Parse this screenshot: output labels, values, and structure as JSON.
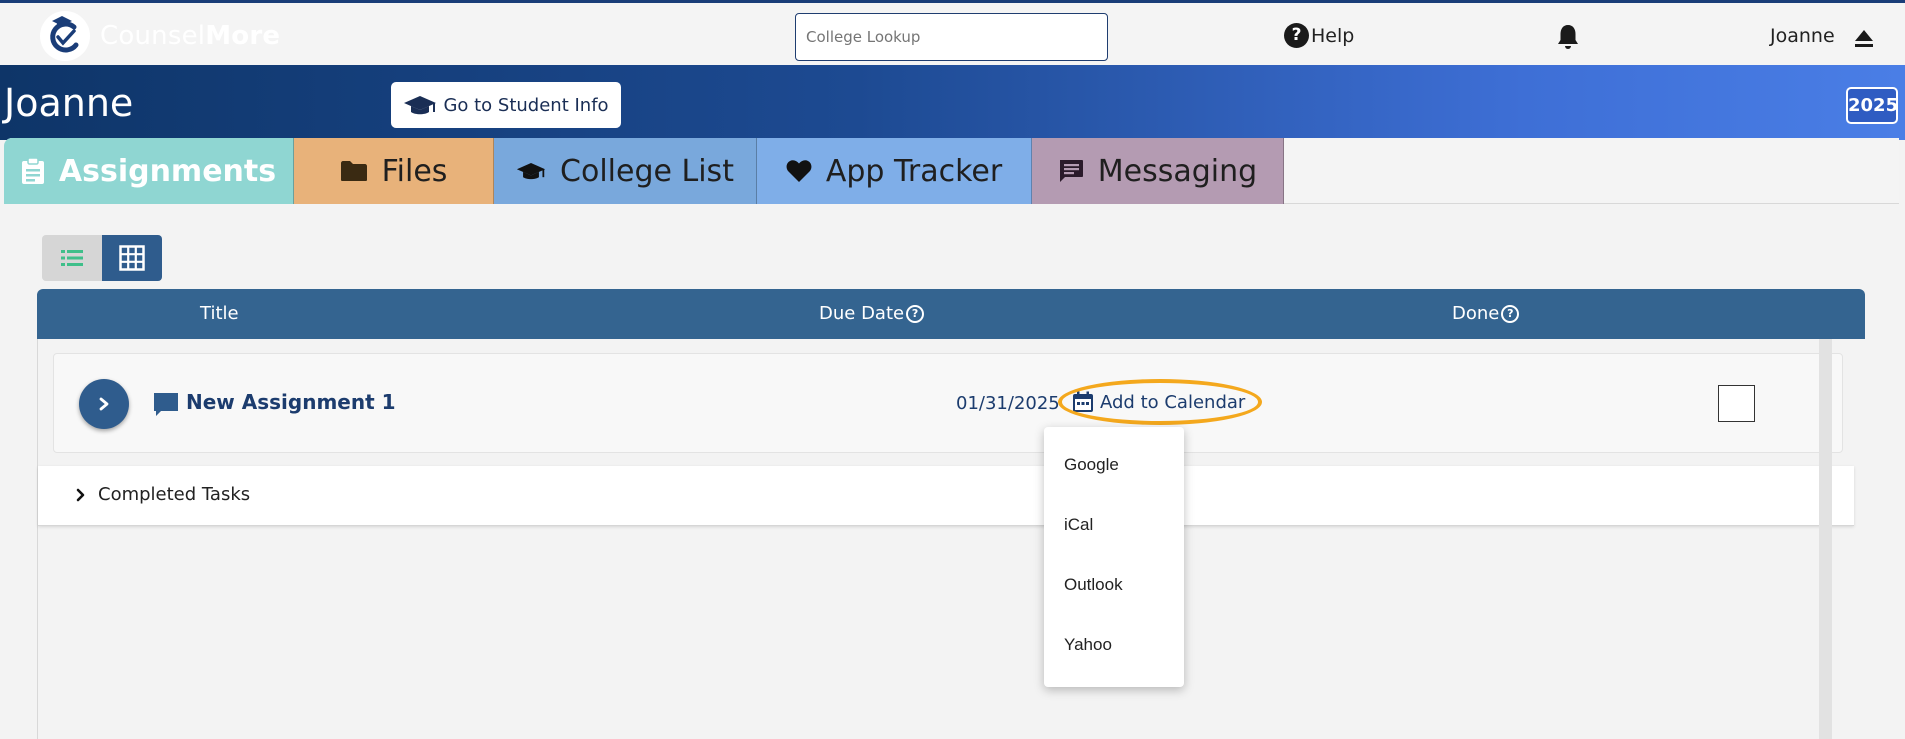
{
  "header": {
    "logo_brand_light": "Counsel",
    "logo_brand_bold": "More",
    "search_placeholder": "College Lookup",
    "help_label": "Help",
    "user_name": "Joanne"
  },
  "banner": {
    "student_name": "Joanne",
    "student_info_button": "Go to Student Info",
    "year": "2025"
  },
  "tabs": [
    {
      "label": "Assignments",
      "icon": "clipboard-icon",
      "color": "#8fd6d2"
    },
    {
      "label": "Files",
      "icon": "folder-icon",
      "color": "#e8b27a"
    },
    {
      "label": "College List",
      "icon": "graduation-cap-icon",
      "color": "#79a8dc"
    },
    {
      "label": "App Tracker",
      "icon": "heart-icon",
      "color": "#7faee8"
    },
    {
      "label": "Messaging",
      "icon": "message-icon",
      "color": "#b49bb2"
    }
  ],
  "table": {
    "columns": {
      "title": "Title",
      "due_date": "Due Date",
      "done": "Done"
    },
    "rows": [
      {
        "title": "New Assignment 1",
        "due_date": "01/31/2025",
        "calendar_action": "Add to Calendar",
        "done": false
      }
    ],
    "completed_label": "Completed Tasks"
  },
  "calendar_menu": {
    "options": [
      "Google",
      "iCal",
      "Outlook",
      "Yahoo"
    ]
  },
  "colors": {
    "primary": "#346490",
    "highlight": "#f4a81d",
    "banner_dark": "#0e3568",
    "banner_light": "#4a7ee6"
  }
}
